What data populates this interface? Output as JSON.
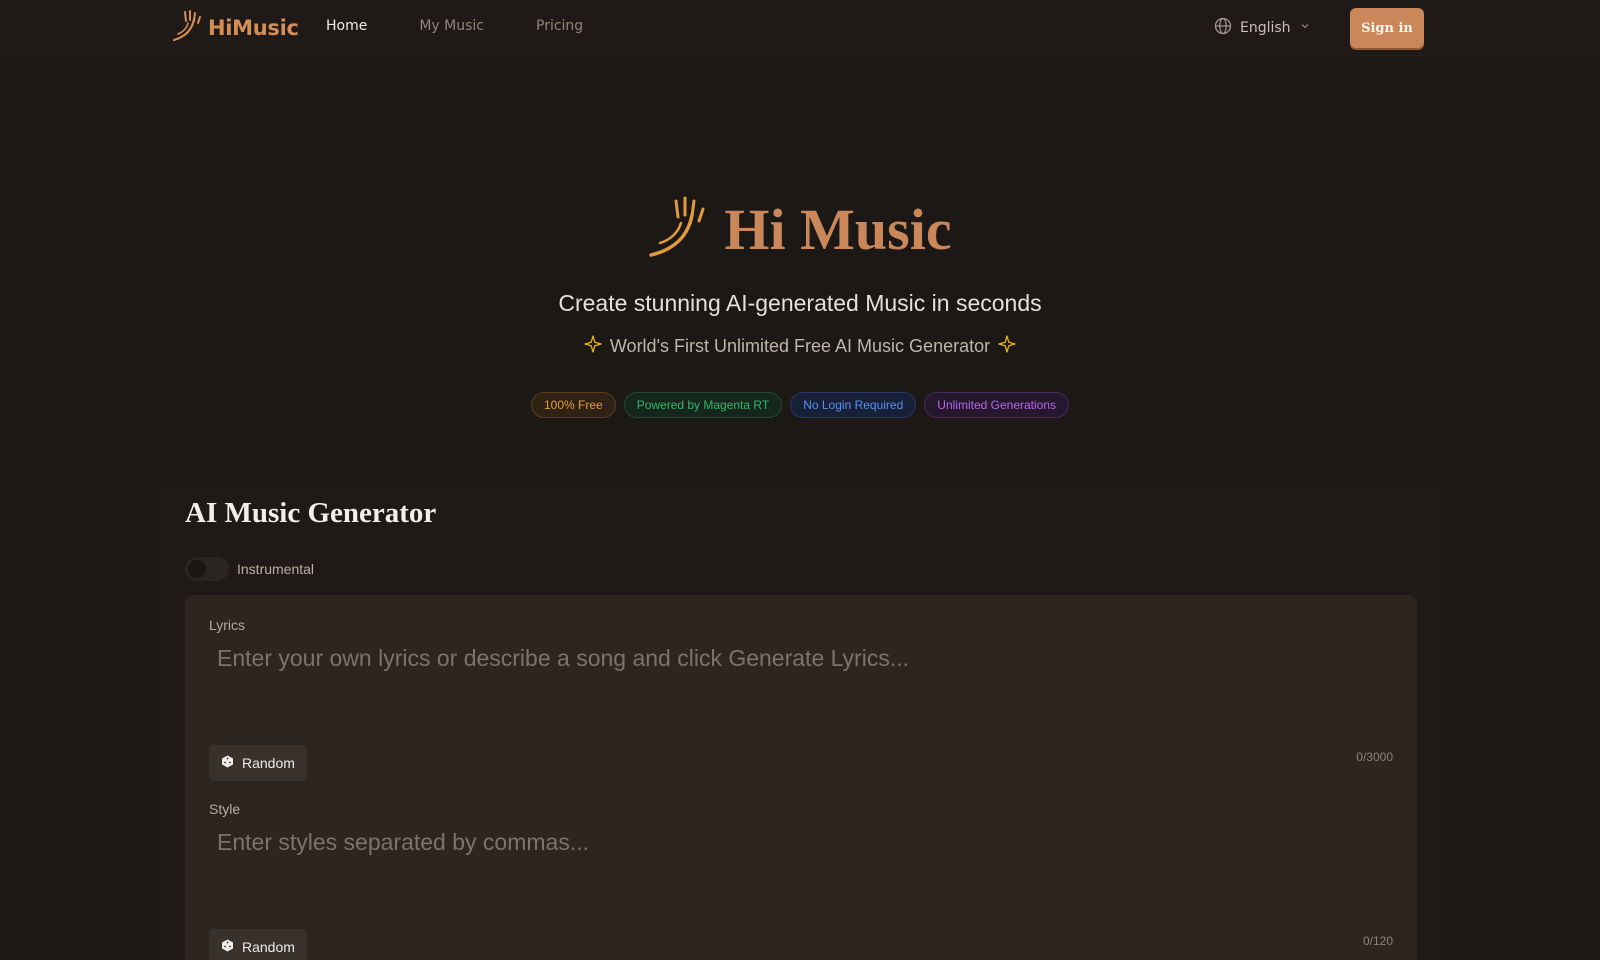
{
  "app": {
    "name": "HiMusic"
  },
  "nav": {
    "items": [
      {
        "label": "Home",
        "active": true
      },
      {
        "label": "My Music",
        "active": false
      },
      {
        "label": "Pricing",
        "active": false
      }
    ]
  },
  "language": {
    "label": "English",
    "icon": "globe-icon"
  },
  "signin": {
    "label": "Sign in"
  },
  "hero": {
    "title": "Hi Music",
    "subtitle": "Create stunning AI-generated Music in seconds",
    "tagline": "World's First Unlimited Free AI Music Generator",
    "badges": [
      {
        "label": "100% Free",
        "color": "#e49c3a"
      },
      {
        "label": "Powered by Magenta RT",
        "color": "#35b56a"
      },
      {
        "label": "No Login Required",
        "color": "#5a8ff0"
      },
      {
        "label": "Unlimited Generations",
        "color": "#b668e6"
      }
    ]
  },
  "generator": {
    "title": "AI Music Generator",
    "instrumental_label": "Instrumental",
    "instrumental_on": false,
    "lyrics": {
      "label": "Lyrics",
      "placeholder": "Enter your own lyrics or describe a song and click Generate Lyrics...",
      "value": "",
      "random_label": "Random",
      "counter": "0/3000"
    },
    "style": {
      "label": "Style",
      "placeholder": "Enter styles separated by commas...",
      "value": "",
      "random_label": "Random",
      "counter": "0/120"
    }
  },
  "colors": {
    "accent": "#c9875a",
    "background": "#1c1815"
  }
}
